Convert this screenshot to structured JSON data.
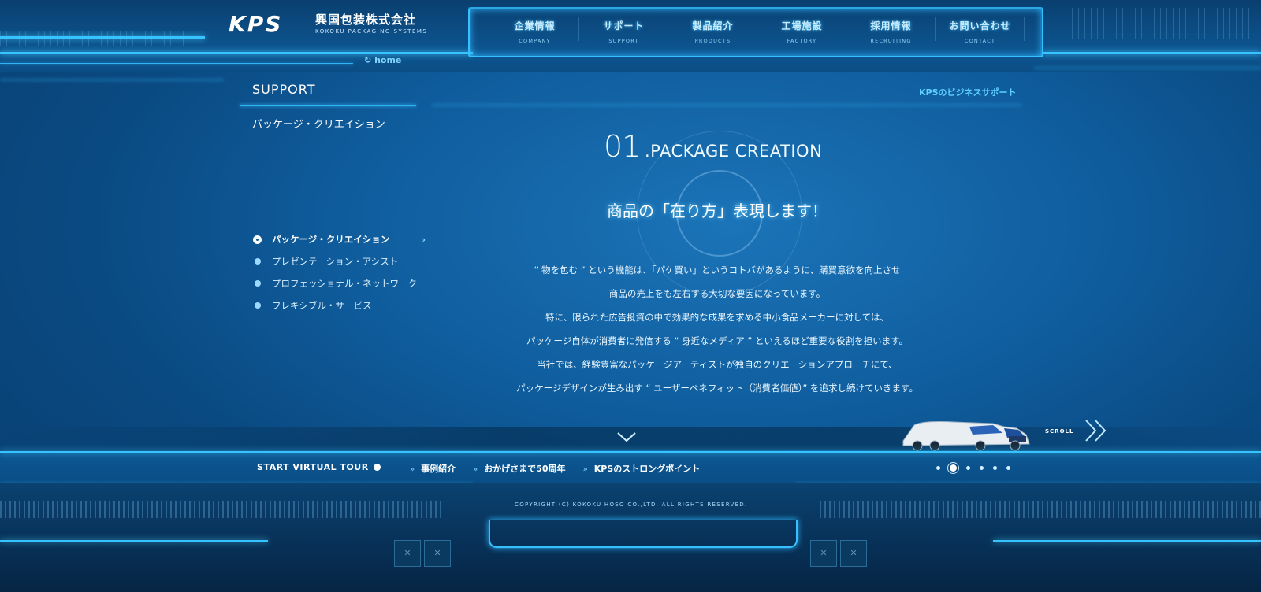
{
  "brand": {
    "logo": "KPS",
    "name_jp": "興国包装株式会社",
    "name_en": "KOKOKU PACKAGING SYSTEMS"
  },
  "nav": [
    {
      "jp": "企業情報",
      "en": "COMPANY"
    },
    {
      "jp": "サポート",
      "en": "SUPPORT"
    },
    {
      "jp": "製品紹介",
      "en": "PRODUCTS"
    },
    {
      "jp": "工場施設",
      "en": "FACTORY"
    },
    {
      "jp": "採用情報",
      "en": "RECRUITING"
    },
    {
      "jp": "お問い合わせ",
      "en": "CONTACT"
    }
  ],
  "home_label": "home",
  "section": {
    "label": "SUPPORT",
    "sub": "パッケージ・クリエイション",
    "right_label": "KPSのビジネスサポート"
  },
  "submenu": [
    {
      "label": "パッケージ・クリエイション",
      "active": true
    },
    {
      "label": "プレゼンテーション・アシスト",
      "active": false
    },
    {
      "label": "プロフェッショナル・ネットワーク",
      "active": false
    },
    {
      "label": "フレキシブル・サービス",
      "active": false
    }
  ],
  "main": {
    "number": "01",
    "title": ".PACKAGE CREATION",
    "headline": "商品の「在り方」表現します！",
    "paragraphs": [
      "“ 物を包む ” という機能は、「パケ買い」というコトバがあるように、購買意欲を向上させ",
      "商品の売上をも左右する大切な要因になっています。",
      "特に、限られた広告投資の中で効果的な成果を求める中小食品メーカーに対しては、",
      "パッケージ自体が消費者に発信する “ 身近なメディア ” といえるほど重要な役割を担います。",
      "当社では、経験豊富なパッケージアーティストが独自のクリエーションアプローチにて、",
      "パッケージデザインが生み出す “ ユーザーベネフィット（消費者価値）” を追求し続けていきます。"
    ]
  },
  "scroll_label": "SCROLL",
  "bottom": {
    "tour": "START VIRTUAL TOUR",
    "links": [
      "事例紹介",
      "おかげさまで50周年",
      "KPSのストロングポイント"
    ],
    "pager_count": 6,
    "pager_active": 2
  },
  "footer": {
    "copyright": "COPYRIGHT (C) KOKOKU HOSO CO.,LTD. ALL RIGHTS RESERVED.",
    "box_glyph": "✕"
  },
  "colors": {
    "accent": "#35c0ff",
    "background": "#0f5c9c",
    "text": "#ffffff"
  }
}
